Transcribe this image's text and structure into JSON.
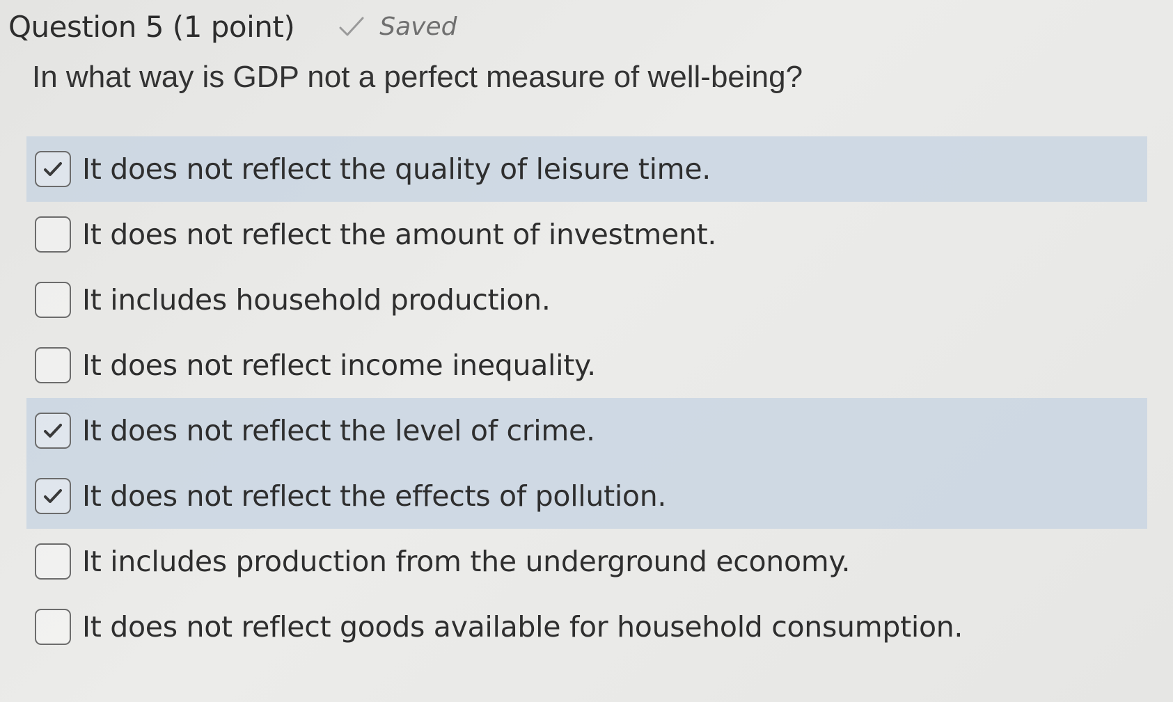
{
  "header": {
    "title": "Question 5 (1 point)",
    "status_icon": "check-icon",
    "status_text": "Saved"
  },
  "question": {
    "text": "In what way is GDP not a perfect measure of well-being?"
  },
  "options": [
    {
      "label": "It does not reflect the quality of leisure time.",
      "checked": true
    },
    {
      "label": "It does not reflect the amount of investment.",
      "checked": false
    },
    {
      "label": "It includes household production.",
      "checked": false
    },
    {
      "label": "It does not reflect income inequality.",
      "checked": false
    },
    {
      "label": "It does not reflect the level of crime.",
      "checked": true
    },
    {
      "label": "It does not reflect the effects of pollution.",
      "checked": true
    },
    {
      "label": "It includes production from the underground economy.",
      "checked": false
    },
    {
      "label": "It does not reflect goods available for household consumption.",
      "checked": false
    }
  ],
  "colors": {
    "selected_row": "#c6d3e2",
    "text": "#2e2e2e",
    "saved": "#6f6f6f"
  }
}
